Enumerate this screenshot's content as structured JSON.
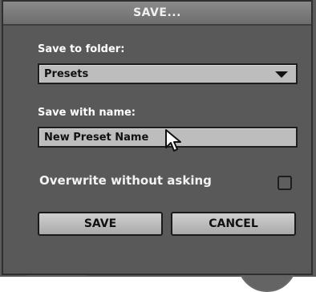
{
  "dialog": {
    "title": "SAVE...",
    "folder_label": "Save to folder:",
    "folder_value": "Presets",
    "name_label": "Save with name:",
    "name_value": "New Preset Name",
    "overwrite_label": "Overwrite without asking",
    "overwrite_checked": false,
    "save_label": "SAVE",
    "cancel_label": "CANCEL"
  },
  "colors": {
    "dialog_bg": "#595959",
    "field_bg": "#bdbdbd",
    "button_bg": "#c0c0c0",
    "title_text": "#f0f0f0"
  },
  "icons": {
    "dropdown": "chevron-down-icon",
    "cursor": "mouse-pointer-icon"
  }
}
